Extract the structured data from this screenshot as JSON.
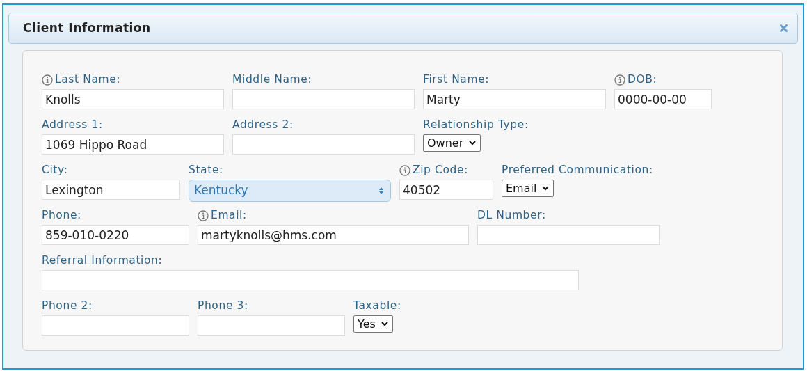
{
  "dialog": {
    "title": "Client Information"
  },
  "rows": [
    [
      {
        "label": "Last Name:",
        "info": true,
        "kind": "text",
        "value": "Knolls"
      },
      {
        "label": "Middle Name:",
        "info": false,
        "kind": "text"
      },
      {
        "label": "First Name:",
        "info": false,
        "kind": "text",
        "value": "Marty"
      },
      {
        "label": "DOB:",
        "info": true,
        "kind": "text",
        "value": "0000-00-00"
      }
    ],
    [
      {
        "label": "Address 1:",
        "info": false,
        "kind": "text",
        "value": "1069 Hippo Road"
      },
      {
        "label": "Address 2:",
        "info": false,
        "kind": "text"
      },
      {
        "label": "Relationship Type:",
        "info": false,
        "kind": "select",
        "value": "Owner"
      }
    ],
    [
      {
        "label": "City:",
        "info": false,
        "kind": "text",
        "value": "Lexington"
      },
      {
        "label": "State:",
        "info": false,
        "kind": "styled-select",
        "value": "Kentucky"
      },
      {
        "label": "Zip Code:",
        "info": true,
        "kind": "text",
        "value": "40502"
      },
      {
        "label": "Preferred Communication:",
        "info": false,
        "kind": "select",
        "value": "Email"
      }
    ],
    [
      {
        "label": "Phone:",
        "info": false,
        "kind": "text",
        "value": "859-010-0220"
      },
      {
        "label": "Email:",
        "info": true,
        "kind": "text",
        "value": "martyknolls@hms.com"
      },
      {
        "label": "DL Number:",
        "info": false,
        "kind": "text"
      }
    ],
    [
      {
        "label": "Referral Information:",
        "info": false,
        "kind": "text"
      }
    ],
    [
      {
        "label": "Phone 2:",
        "info": false,
        "kind": "text"
      },
      {
        "label": "Phone 3:",
        "info": false,
        "kind": "text"
      },
      {
        "label": "Taxable:",
        "info": false,
        "kind": "select",
        "value": "Yes"
      }
    ]
  ]
}
